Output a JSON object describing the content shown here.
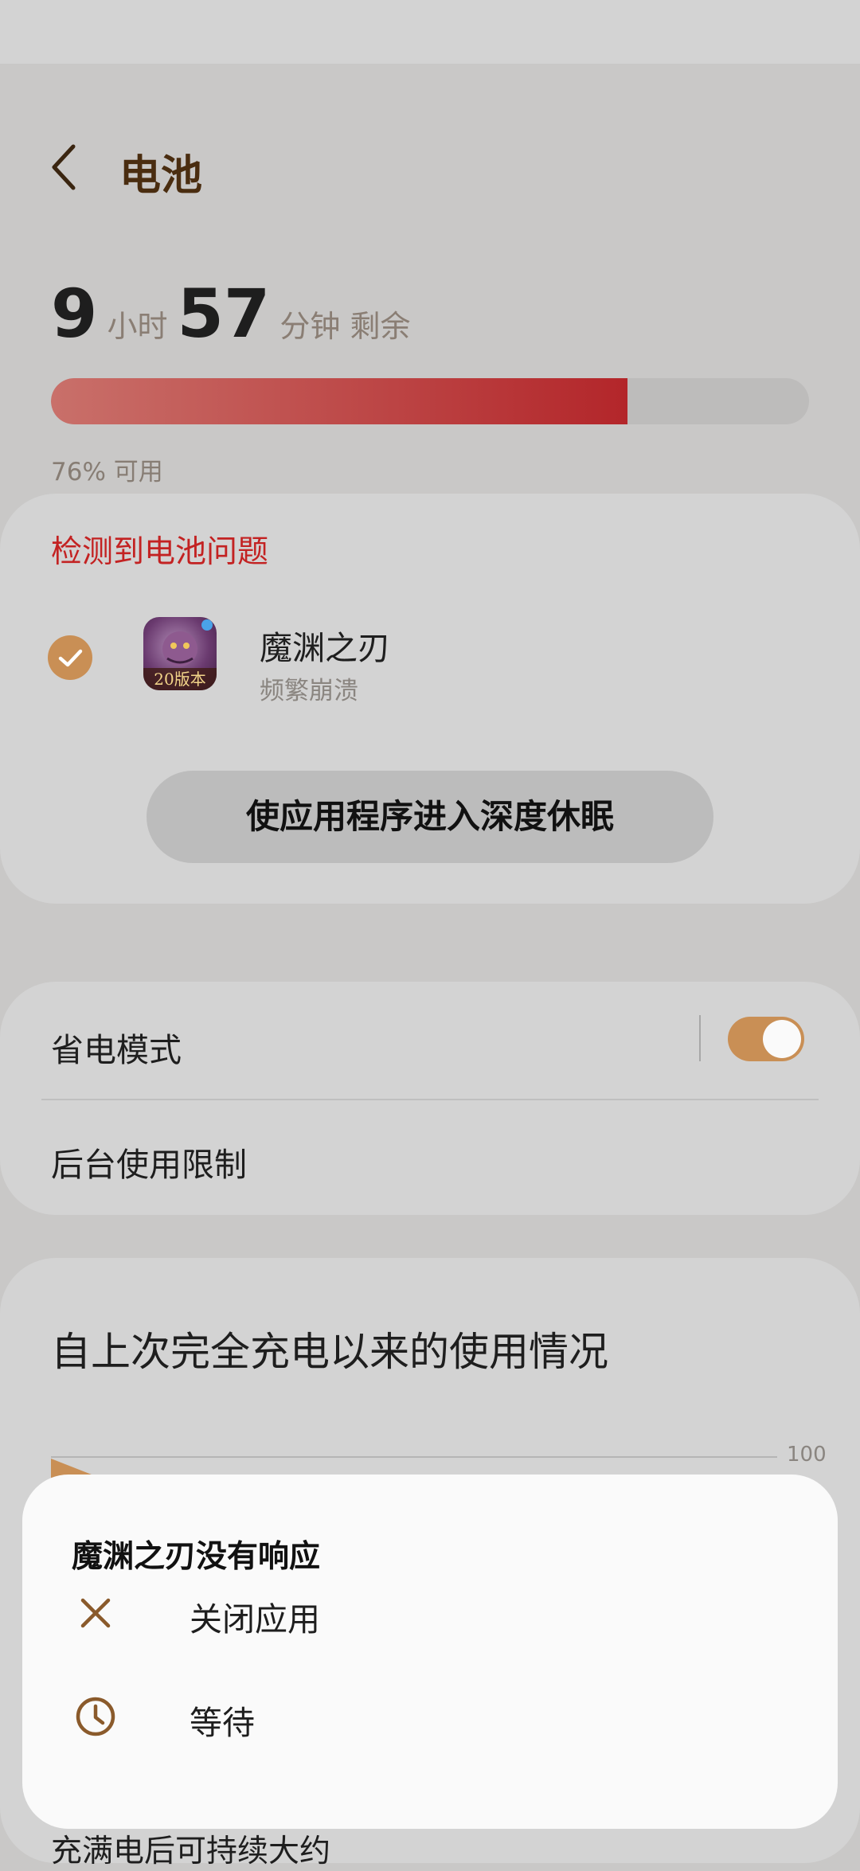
{
  "header": {
    "title": "电池"
  },
  "battery": {
    "hours": "9",
    "hours_unit": "小时",
    "minutes": "57",
    "minutes_unit": "分钟 剩余",
    "level_fraction": 0.76,
    "percent_text": "76% 可用"
  },
  "problem": {
    "title": "检测到电池问题",
    "app_name": "魔渊之刃",
    "app_status": "频繁崩溃",
    "app_icon_badge": "20版本",
    "action_label": "使应用程序进入深度休眠"
  },
  "settings": {
    "power_save_label": "省电模式",
    "power_save_on": true,
    "bg_limit_label": "后台使用限制"
  },
  "usage": {
    "title": "自上次完全充电以来的使用情况",
    "tick_max": "100",
    "full_charge_text": "充满电后可持续大约"
  },
  "dialog": {
    "title": "魔渊之刃没有响应",
    "close_label": "关闭应用",
    "wait_label": "等待"
  },
  "colors": {
    "accent": "#c98f55",
    "alert_red": "#c32222",
    "bar_fill_end": "#b3262a"
  }
}
